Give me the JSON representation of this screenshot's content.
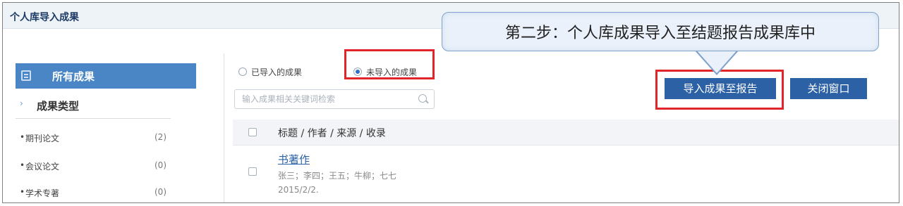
{
  "window": {
    "title": "个人库导入成果"
  },
  "callout": {
    "text": "第二步：个人库成果导入至结题报告成果库中"
  },
  "sidebar": {
    "all_label": "所有成果",
    "type_label": "成果类型",
    "categories": [
      {
        "name": "期刊论文",
        "count": "(2)"
      },
      {
        "name": "会议论文",
        "count": "(0)"
      },
      {
        "name": "学术专著",
        "count": "(0)"
      }
    ]
  },
  "filters": {
    "imported_label": "已导入的成果",
    "not_imported_label": "未导入的成果",
    "selected": "not_imported"
  },
  "search": {
    "placeholder": "输入成果相关关键词检索"
  },
  "actions": {
    "import_label": "导入成果至报告",
    "close_label": "关闭窗口"
  },
  "table": {
    "header": "标题 / 作者 / 来源 / 收录",
    "rows": [
      {
        "title": "书著作",
        "authors": "张三；李四；王五；牛柳；七七",
        "date": "2015/2/2."
      }
    ]
  },
  "colors": {
    "accent": "#2c61a6",
    "highlight": "#e0262b",
    "sidebar_active": "#4a86c5"
  }
}
